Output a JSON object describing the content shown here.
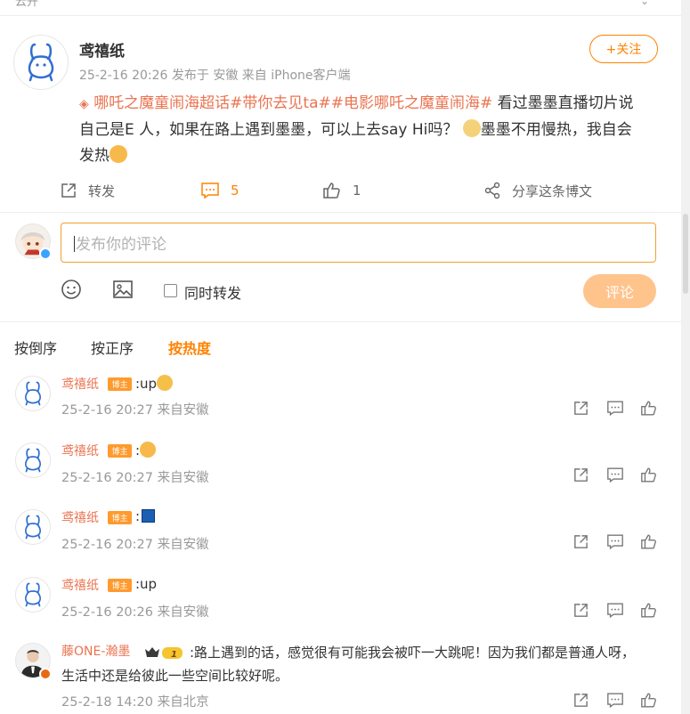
{
  "top_label": "云开",
  "post": {
    "author": "鸢禧纸",
    "meta": "25-2-16 20:26  发布于 安徽  来自 iPhone客户端",
    "follow_label": "+关注",
    "text": {
      "tag_text": "哪吒之魔童闹海超话#带你去见ta##电影哪吒之魔童闹海#",
      "line1_rest": " 看过墨墨直播切片说",
      "line2": "自己是E 人，如果在路上遇到墨墨，可以上去say Hi吗？",
      "line2_tail": "墨墨不用慢热，我自会",
      "line3": "发热"
    },
    "actions": {
      "repost": "转发",
      "comment_count": "5",
      "like_count": "1",
      "share": "分享这条博文"
    }
  },
  "compose": {
    "placeholder": "发布你的评论",
    "repost_label": "同时转发",
    "submit_label": "评论"
  },
  "sort": {
    "tabs": [
      "按倒序",
      "按正序",
      "按热度"
    ],
    "active": "按热度"
  },
  "comments": [
    {
      "name": "鸢禧纸",
      "badge": "博主",
      "text": ":up",
      "meta": "25-2-16 20:27 来自安徽"
    },
    {
      "name": "鸢禧纸",
      "badge": "博主",
      "text": ":",
      "meta": "25-2-16 20:27 来自安徽"
    },
    {
      "name": "鸢禧纸",
      "badge": "博主",
      "text": ":",
      "meta": "25-2-16 20:27 来自安徽"
    },
    {
      "name": "鸢禧纸",
      "badge": "博主",
      "text": ":up",
      "meta": "25-2-16 20:26 来自安徽"
    },
    {
      "name": "藤ONE-瀚墨",
      "badge_icon": "crown-level-badge",
      "badge_level": "1",
      "text_line1": ":路上遇到的话，感觉很有可能我会被吓一大跳呢！因为我们都是普通人呀，",
      "text_line2": "生活中还是给彼此一些空间比较好呢。",
      "meta": "25-2-18 14:20 来自北京"
    }
  ],
  "colors": {
    "accent": "#ff8200",
    "link": "#eb7350",
    "muted": "#999999",
    "submit_disabled": "#ffc38c"
  }
}
